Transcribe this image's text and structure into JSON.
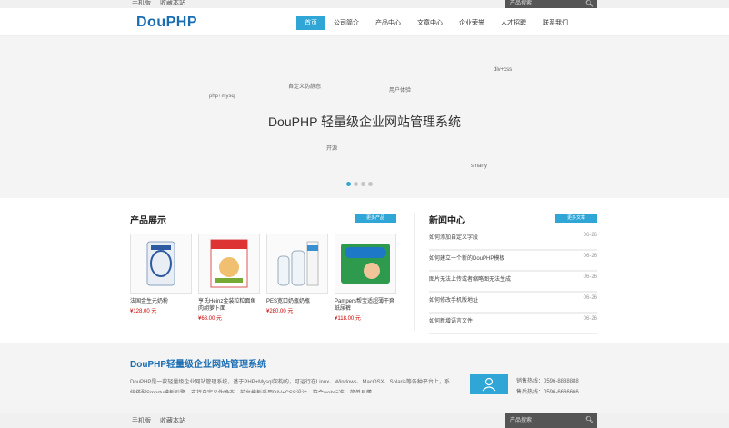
{
  "topbar": {
    "mobile_link": "手机版",
    "favorite_link": "收藏本站",
    "search_placeholder": "产品搜索"
  },
  "header": {
    "logo_text": "DouPHP",
    "nav": [
      "首页",
      "公司简介",
      "产品中心",
      "文章中心",
      "企业荣誉",
      "人才招聘",
      "联系我们"
    ],
    "active_nav": "首页"
  },
  "banner": {
    "title": "DouPHP 轻量级企业网站管理系统",
    "tags": [
      "div+css",
      "自定义伪静态",
      "用户体验",
      "php+mysql",
      "开源",
      "smarty"
    ],
    "slides": 4,
    "active_slide": 1
  },
  "products": {
    "title": "产品展示",
    "more_label": "更多产品",
    "items": [
      {
        "name": "法国金生元奶粉",
        "price": "¥128.00 元"
      },
      {
        "name": "亨氏Heinz金装粒粒面鱼肉胡萝卜面",
        "price": "¥68.00 元"
      },
      {
        "name": "PES宽口奶瓶奶瓶",
        "price": "¥280.00 元"
      },
      {
        "name": "Pampers帮宝适超薄干爽纸尿裤",
        "price": "¥118.00 元"
      }
    ]
  },
  "news": {
    "title": "新闻中心",
    "more_label": "更多文章",
    "items": [
      {
        "title": "如何添加自定义字段",
        "date": "06-26"
      },
      {
        "title": "如何建立一个新的DouPHP模板",
        "date": "06-26"
      },
      {
        "title": "图片无法上传或者缩略图无法生成",
        "date": "06-26"
      },
      {
        "title": "如何修改手机版地址",
        "date": "06-26"
      },
      {
        "title": "如何新增语言文件",
        "date": "06-26"
      }
    ]
  },
  "about": {
    "title": "DouPHP轻量级企业网站管理系统",
    "description": "DouPHP是一款轻量级企业网站管理系统，基于PHP+Mysql架构的，可运行在Linux、Windows、MacOSX、Solaris等各种平台上，系统搭配Smarty模板引擎，支持自定义伪静态，前台模板采用DIV+CSS设计，符合web标准，简单易懂。",
    "contact_phone_label": "销售热线：0596-8888888",
    "contact_service_label": "售后热线：0596-6666666"
  },
  "colors": {
    "accent": "#30a6d7",
    "brand": "#1a6db3",
    "price": "#cc0000"
  }
}
